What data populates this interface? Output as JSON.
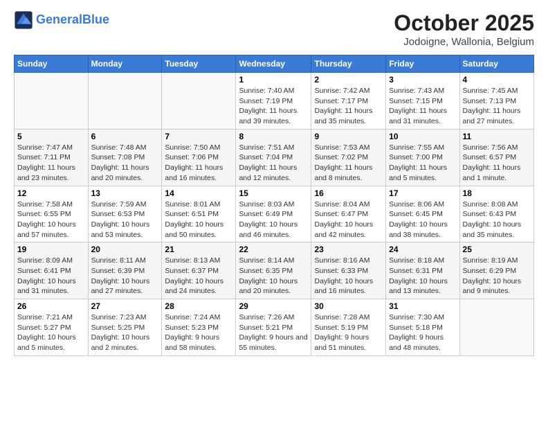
{
  "header": {
    "logo_line1": "General",
    "logo_line2": "Blue",
    "month_year": "October 2025",
    "location": "Jodoigne, Wallonia, Belgium"
  },
  "weekdays": [
    "Sunday",
    "Monday",
    "Tuesday",
    "Wednesday",
    "Thursday",
    "Friday",
    "Saturday"
  ],
  "weeks": [
    [
      {
        "day": "",
        "info": ""
      },
      {
        "day": "",
        "info": ""
      },
      {
        "day": "",
        "info": ""
      },
      {
        "day": "1",
        "info": "Sunrise: 7:40 AM\nSunset: 7:19 PM\nDaylight: 11 hours and 39 minutes."
      },
      {
        "day": "2",
        "info": "Sunrise: 7:42 AM\nSunset: 7:17 PM\nDaylight: 11 hours and 35 minutes."
      },
      {
        "day": "3",
        "info": "Sunrise: 7:43 AM\nSunset: 7:15 PM\nDaylight: 11 hours and 31 minutes."
      },
      {
        "day": "4",
        "info": "Sunrise: 7:45 AM\nSunset: 7:13 PM\nDaylight: 11 hours and 27 minutes."
      }
    ],
    [
      {
        "day": "5",
        "info": "Sunrise: 7:47 AM\nSunset: 7:11 PM\nDaylight: 11 hours and 23 minutes."
      },
      {
        "day": "6",
        "info": "Sunrise: 7:48 AM\nSunset: 7:08 PM\nDaylight: 11 hours and 20 minutes."
      },
      {
        "day": "7",
        "info": "Sunrise: 7:50 AM\nSunset: 7:06 PM\nDaylight: 11 hours and 16 minutes."
      },
      {
        "day": "8",
        "info": "Sunrise: 7:51 AM\nSunset: 7:04 PM\nDaylight: 11 hours and 12 minutes."
      },
      {
        "day": "9",
        "info": "Sunrise: 7:53 AM\nSunset: 7:02 PM\nDaylight: 11 hours and 8 minutes."
      },
      {
        "day": "10",
        "info": "Sunrise: 7:55 AM\nSunset: 7:00 PM\nDaylight: 11 hours and 5 minutes."
      },
      {
        "day": "11",
        "info": "Sunrise: 7:56 AM\nSunset: 6:57 PM\nDaylight: 11 hours and 1 minute."
      }
    ],
    [
      {
        "day": "12",
        "info": "Sunrise: 7:58 AM\nSunset: 6:55 PM\nDaylight: 10 hours and 57 minutes."
      },
      {
        "day": "13",
        "info": "Sunrise: 7:59 AM\nSunset: 6:53 PM\nDaylight: 10 hours and 53 minutes."
      },
      {
        "day": "14",
        "info": "Sunrise: 8:01 AM\nSunset: 6:51 PM\nDaylight: 10 hours and 50 minutes."
      },
      {
        "day": "15",
        "info": "Sunrise: 8:03 AM\nSunset: 6:49 PM\nDaylight: 10 hours and 46 minutes."
      },
      {
        "day": "16",
        "info": "Sunrise: 8:04 AM\nSunset: 6:47 PM\nDaylight: 10 hours and 42 minutes."
      },
      {
        "day": "17",
        "info": "Sunrise: 8:06 AM\nSunset: 6:45 PM\nDaylight: 10 hours and 38 minutes."
      },
      {
        "day": "18",
        "info": "Sunrise: 8:08 AM\nSunset: 6:43 PM\nDaylight: 10 hours and 35 minutes."
      }
    ],
    [
      {
        "day": "19",
        "info": "Sunrise: 8:09 AM\nSunset: 6:41 PM\nDaylight: 10 hours and 31 minutes."
      },
      {
        "day": "20",
        "info": "Sunrise: 8:11 AM\nSunset: 6:39 PM\nDaylight: 10 hours and 27 minutes."
      },
      {
        "day": "21",
        "info": "Sunrise: 8:13 AM\nSunset: 6:37 PM\nDaylight: 10 hours and 24 minutes."
      },
      {
        "day": "22",
        "info": "Sunrise: 8:14 AM\nSunset: 6:35 PM\nDaylight: 10 hours and 20 minutes."
      },
      {
        "day": "23",
        "info": "Sunrise: 8:16 AM\nSunset: 6:33 PM\nDaylight: 10 hours and 16 minutes."
      },
      {
        "day": "24",
        "info": "Sunrise: 8:18 AM\nSunset: 6:31 PM\nDaylight: 10 hours and 13 minutes."
      },
      {
        "day": "25",
        "info": "Sunrise: 8:19 AM\nSunset: 6:29 PM\nDaylight: 10 hours and 9 minutes."
      }
    ],
    [
      {
        "day": "26",
        "info": "Sunrise: 7:21 AM\nSunset: 5:27 PM\nDaylight: 10 hours and 5 minutes."
      },
      {
        "day": "27",
        "info": "Sunrise: 7:23 AM\nSunset: 5:25 PM\nDaylight: 10 hours and 2 minutes."
      },
      {
        "day": "28",
        "info": "Sunrise: 7:24 AM\nSunset: 5:23 PM\nDaylight: 9 hours and 58 minutes."
      },
      {
        "day": "29",
        "info": "Sunrise: 7:26 AM\nSunset: 5:21 PM\nDaylight: 9 hours and 55 minutes."
      },
      {
        "day": "30",
        "info": "Sunrise: 7:28 AM\nSunset: 5:19 PM\nDaylight: 9 hours and 51 minutes."
      },
      {
        "day": "31",
        "info": "Sunrise: 7:30 AM\nSunset: 5:18 PM\nDaylight: 9 hours and 48 minutes."
      },
      {
        "day": "",
        "info": ""
      }
    ]
  ]
}
